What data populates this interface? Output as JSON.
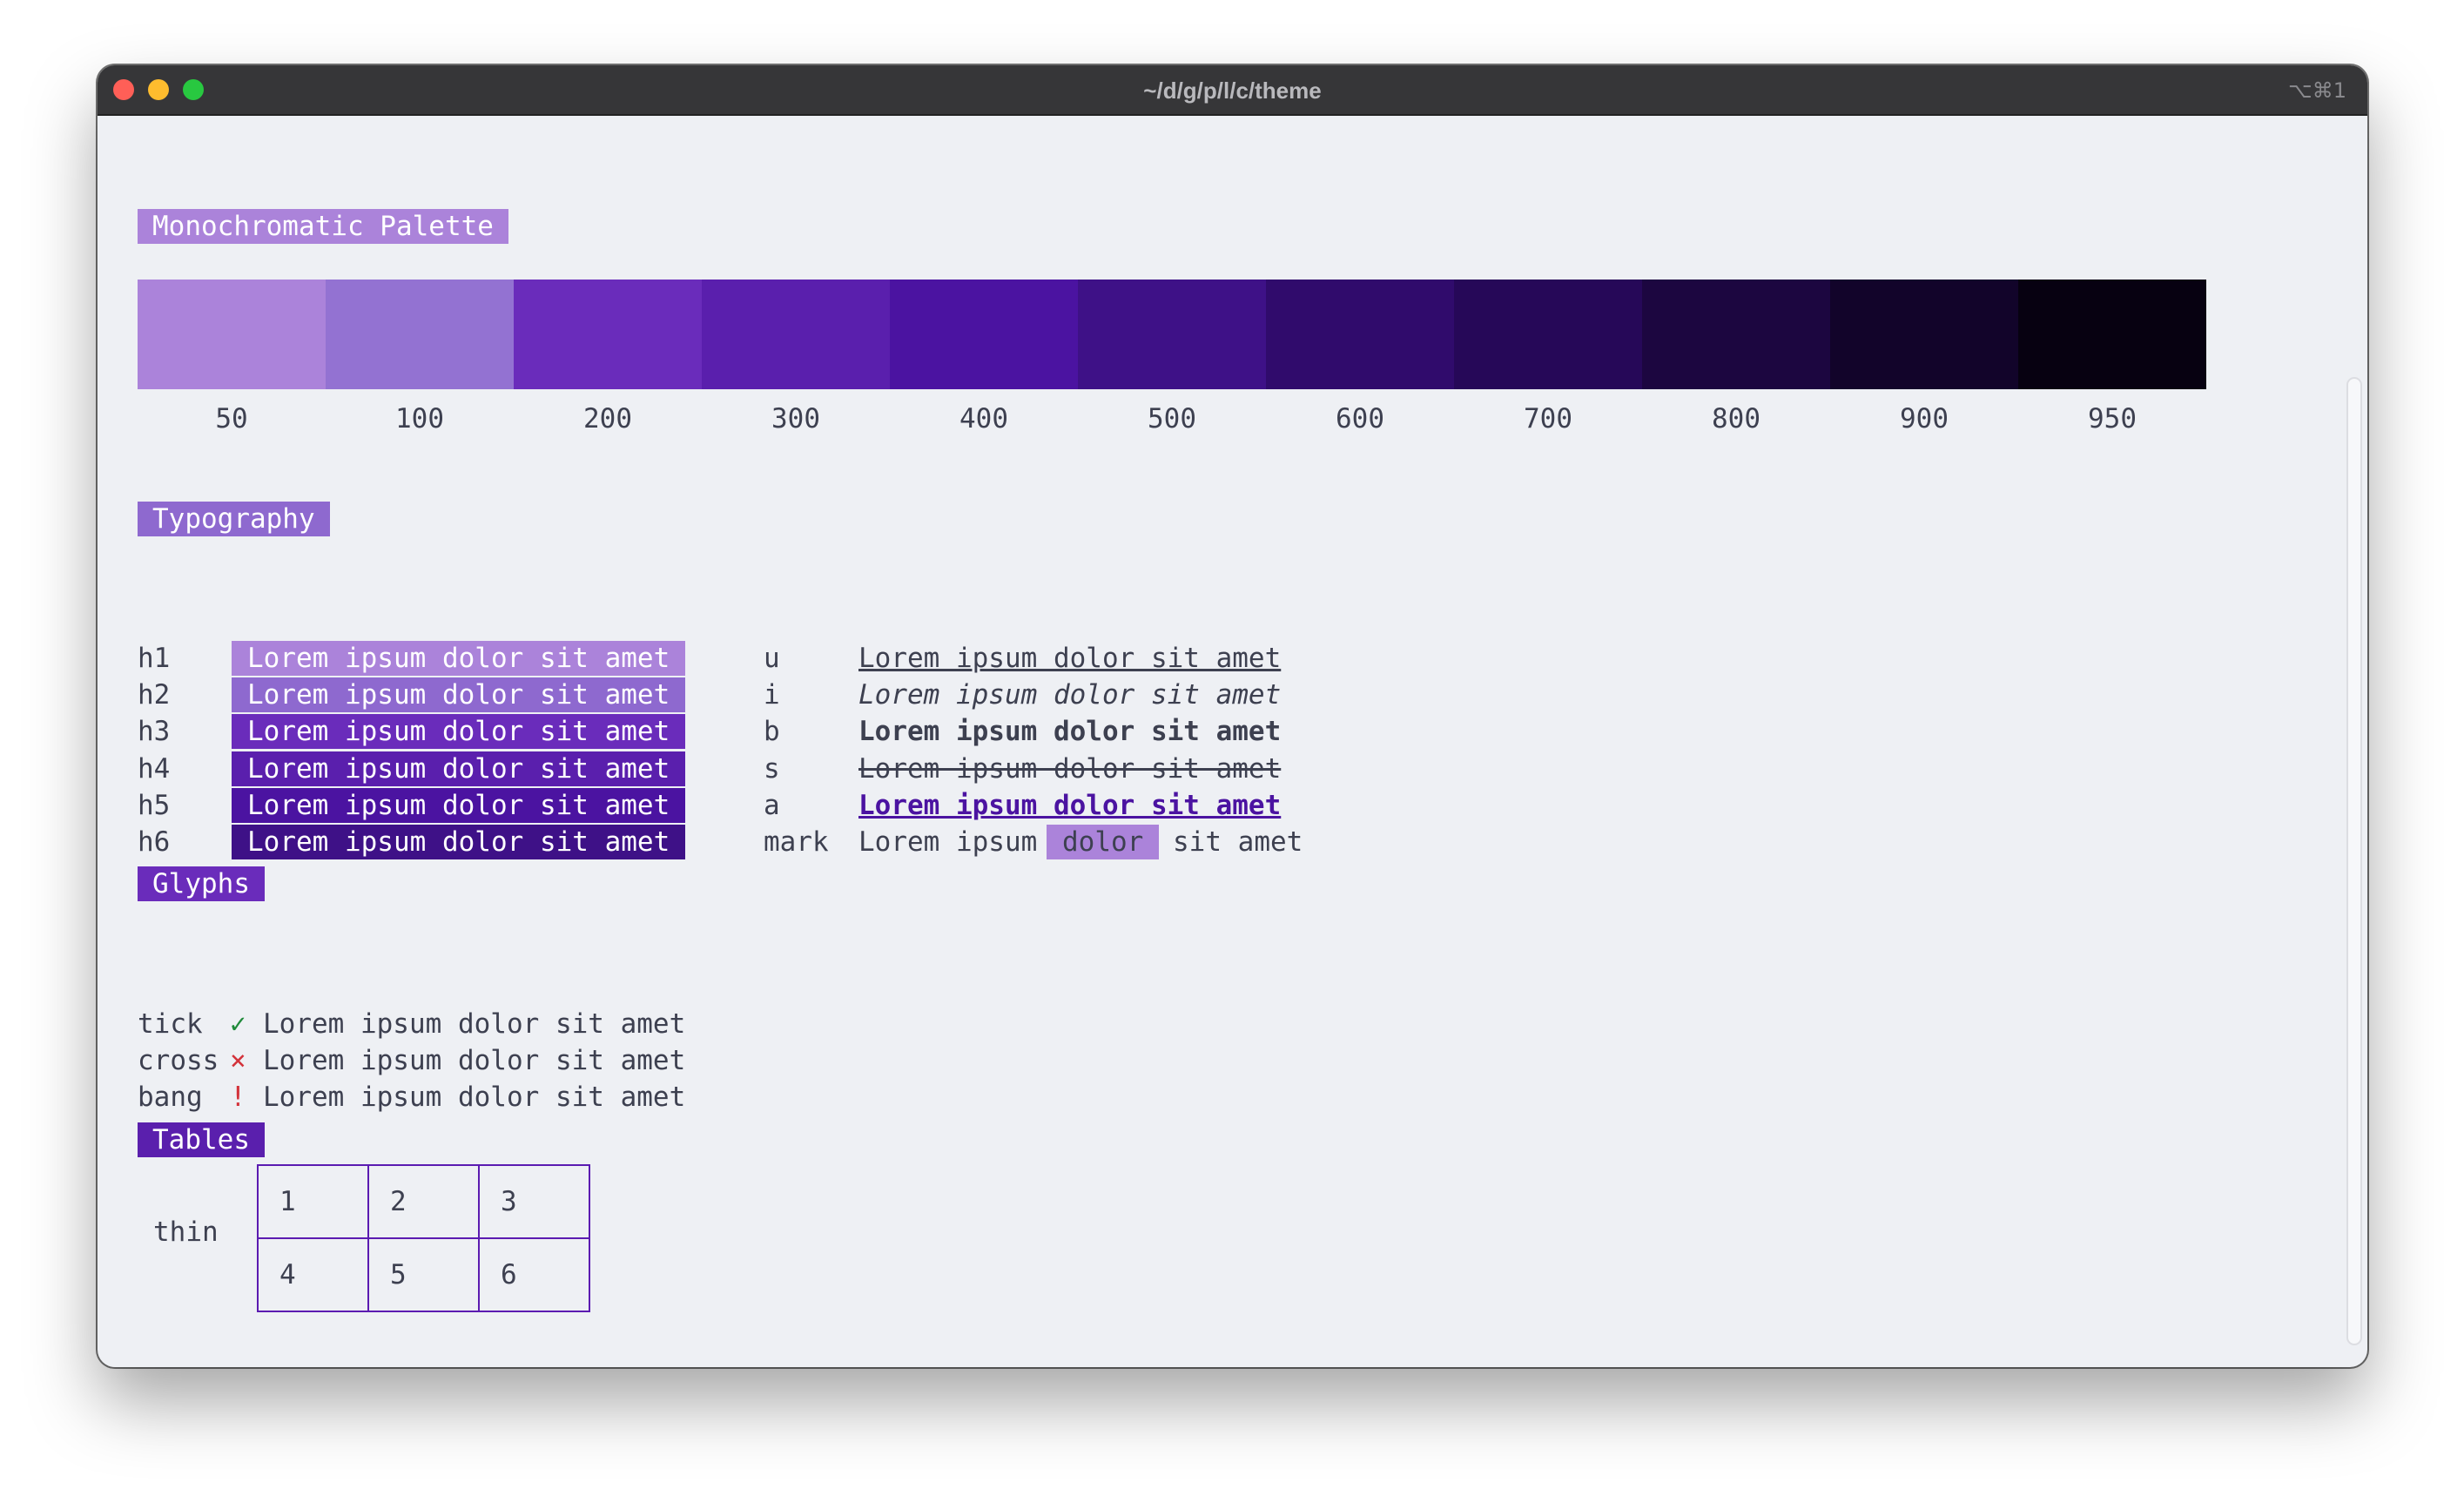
{
  "window": {
    "title": "~/d/g/p/l/c/theme",
    "shortcut": "⌥⌘1"
  },
  "palette": {
    "heading": "Monochromatic Palette",
    "swatches": [
      {
        "label": "50",
        "color": "#ab83da"
      },
      {
        "label": "100",
        "color": "#9372d2"
      },
      {
        "label": "200",
        "color": "#6a2cbb"
      },
      {
        "label": "300",
        "color": "#5a1fad"
      },
      {
        "label": "400",
        "color": "#4b13a1"
      },
      {
        "label": "500",
        "color": "#3e1187"
      },
      {
        "label": "600",
        "color": "#300b6c"
      },
      {
        "label": "700",
        "color": "#260858"
      },
      {
        "label": "800",
        "color": "#1c0640"
      },
      {
        "label": "900",
        "color": "#12042a"
      },
      {
        "label": "950",
        "color": "#070111"
      }
    ]
  },
  "typography": {
    "heading": "Typography",
    "headings": [
      {
        "tag": "h1",
        "text": "Lorem ipsum dolor sit amet",
        "color": "#ab83da"
      },
      {
        "tag": "h2",
        "text": "Lorem ipsum dolor sit amet",
        "color": "#8e69cf"
      },
      {
        "tag": "h3",
        "text": "Lorem ipsum dolor sit amet",
        "color": "#6a2cbb"
      },
      {
        "tag": "h4",
        "text": "Lorem ipsum dolor sit amet",
        "color": "#5a1fad"
      },
      {
        "tag": "h5",
        "text": "Lorem ipsum dolor sit amet",
        "color": "#4b13a1"
      },
      {
        "tag": "h6",
        "text": "Lorem ipsum dolor sit amet",
        "color": "#3e1187"
      }
    ],
    "styles": [
      {
        "tag": "u",
        "text": "Lorem ipsum dolor sit amet"
      },
      {
        "tag": "i",
        "text": "Lorem ipsum dolor sit amet"
      },
      {
        "tag": "b",
        "text": "Lorem ipsum dolor sit amet"
      },
      {
        "tag": "s",
        "text": "Lorem ipsum dolor sit amet"
      },
      {
        "tag": "a",
        "text": "Lorem ipsum dolor sit amet",
        "color": "#4b13a1"
      }
    ],
    "mark": {
      "tag": "mark",
      "before": "Lorem ipsum",
      "marked": "dolor",
      "after": "sit amet",
      "color": "#ab83da"
    }
  },
  "glyphs": {
    "heading": "Glyphs",
    "rows": [
      {
        "name": "tick",
        "glyph": "✓",
        "text": "Lorem ipsum dolor sit amet",
        "color": "#1f8a3a"
      },
      {
        "name": "cross",
        "glyph": "×",
        "text": "Lorem ipsum dolor sit amet",
        "color": "#d3323a"
      },
      {
        "name": "bang",
        "glyph": "!",
        "text": "Lorem ipsum dolor sit amet",
        "color": "#d3323a"
      }
    ]
  },
  "tables": {
    "heading": "Tables",
    "thin": {
      "label": "thin",
      "rows": [
        [
          "1",
          "2",
          "3"
        ],
        [
          "4",
          "5",
          "6"
        ]
      ]
    }
  },
  "colors": {
    "heading_palette": "#ab83da",
    "heading_typography": "#8e69cf",
    "heading_glyphs": "#6a2cbb",
    "heading_tables": "#5a1fad",
    "table_border": "#5b1bb1"
  }
}
